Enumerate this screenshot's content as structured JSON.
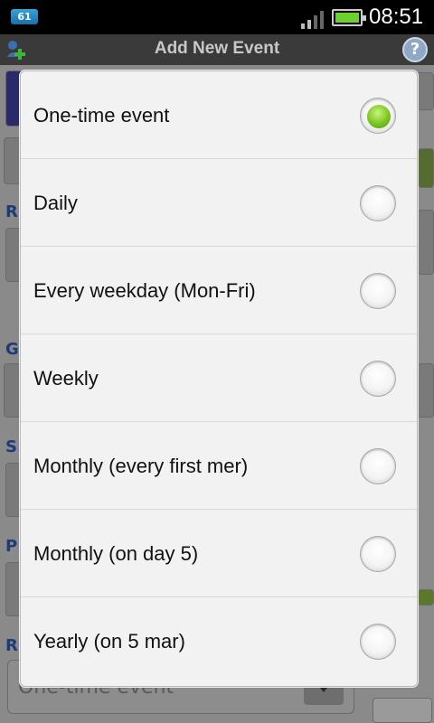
{
  "status_bar": {
    "notification_badge": "61",
    "time": "08:51",
    "battery_percent": 100
  },
  "title_bar": {
    "title": "Add New Event",
    "add_icon": "add-event-icon",
    "help_icon": "help-icon"
  },
  "background_form": {
    "repeat_select_value": "One-time event"
  },
  "dialog": {
    "options": [
      {
        "label": "One-time event",
        "selected": true
      },
      {
        "label": "Daily",
        "selected": false
      },
      {
        "label": "Every weekday (Mon-Fri)",
        "selected": false
      },
      {
        "label": "Weekly",
        "selected": false
      },
      {
        "label": "Monthly (every first mer)",
        "selected": false
      },
      {
        "label": "Monthly (on day 5)",
        "selected": false
      },
      {
        "label": "Yearly (on 5 mar)",
        "selected": false
      }
    ]
  },
  "colors": {
    "radio_selected": "#7bc520",
    "status_bar_bg": "#000000",
    "dialog_bg": "#f2f2f2"
  }
}
